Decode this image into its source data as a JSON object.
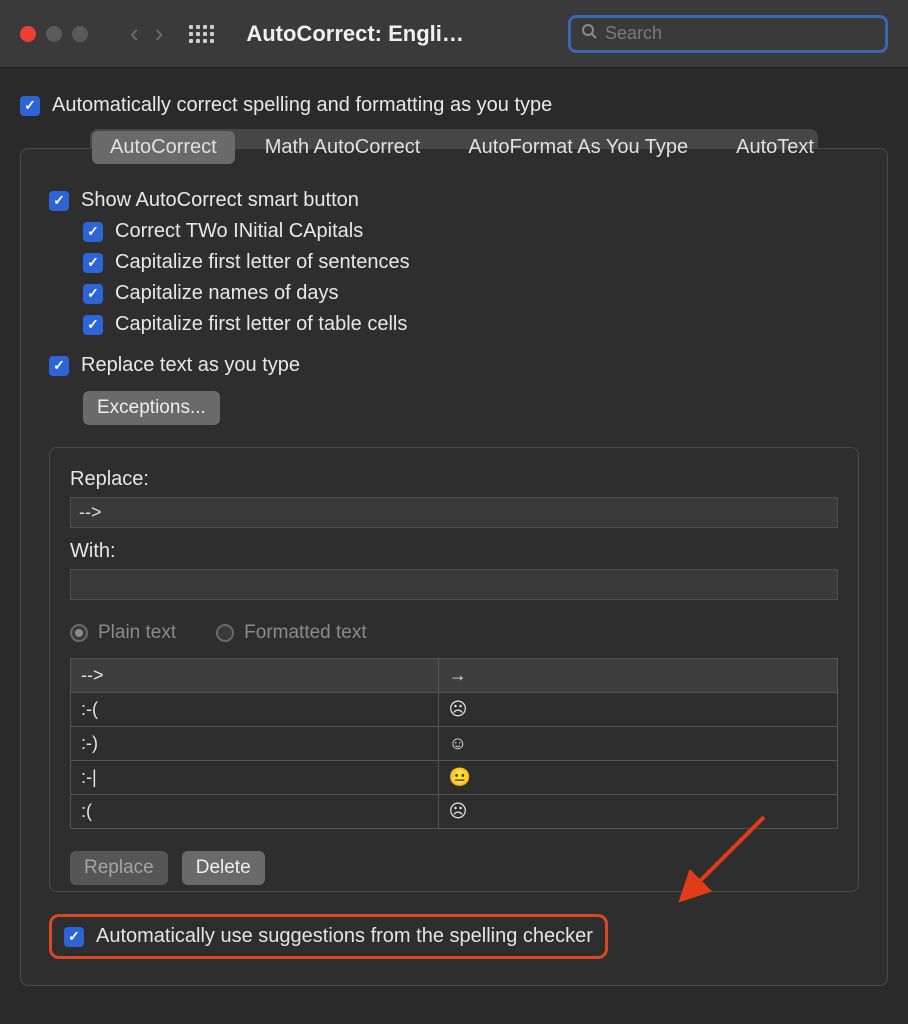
{
  "window": {
    "title": "AutoCorrect: Engli…",
    "search_placeholder": "Search"
  },
  "top_checkbox": {
    "label": "Automatically correct spelling and formatting as you type",
    "checked": true
  },
  "tabs": [
    {
      "label": "AutoCorrect",
      "active": true
    },
    {
      "label": "Math AutoCorrect",
      "active": false
    },
    {
      "label": "AutoFormat As You Type",
      "active": false
    },
    {
      "label": "AutoText",
      "active": false
    }
  ],
  "options": {
    "show_smart": {
      "label": "Show AutoCorrect smart button",
      "checked": true
    },
    "sub": [
      {
        "label": "Correct TWo INitial CApitals",
        "checked": true
      },
      {
        "label": "Capitalize first letter of sentences",
        "checked": true
      },
      {
        "label": "Capitalize names of days",
        "checked": true
      },
      {
        "label": "Capitalize first letter of table cells",
        "checked": true
      }
    ],
    "replace_as_type": {
      "label": "Replace text as you type",
      "checked": true
    },
    "exceptions_button": "Exceptions..."
  },
  "replace_panel": {
    "replace_label": "Replace:",
    "replace_value": "-->",
    "with_label": "With:",
    "with_value": "",
    "radio_plain": "Plain text",
    "radio_formatted": "Formatted text",
    "rows": [
      {
        "left": "-->",
        "right": "→",
        "selected": true
      },
      {
        "left": ":-(",
        "right": "☹",
        "selected": false
      },
      {
        "left": ":-)",
        "right": "☺",
        "selected": false
      },
      {
        "left": ":-|",
        "right": "😐",
        "selected": false
      },
      {
        "left": ":(",
        "right": "☹",
        "selected": false
      }
    ],
    "replace_button": "Replace",
    "delete_button": "Delete"
  },
  "spell_checkbox": {
    "label": "Automatically use suggestions from the spelling checker",
    "checked": true
  }
}
